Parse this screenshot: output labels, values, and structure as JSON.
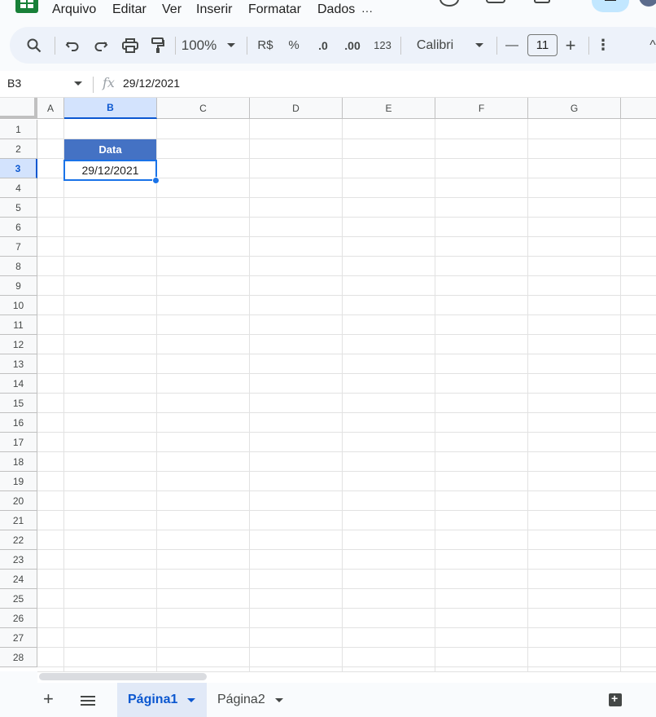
{
  "menu": {
    "items": [
      "Arquivo",
      "Editar",
      "Ver",
      "Inserir",
      "Formatar",
      "Dados"
    ],
    "more": "···"
  },
  "toolbar": {
    "zoom": "100%",
    "currency": "R$",
    "percent": "%",
    "decrease_decimal": ".0",
    "increase_decimal": ".00",
    "number_format": "123",
    "font": "Calibri",
    "font_size": "11",
    "minus": "—",
    "plus": "+",
    "more": "⋮",
    "collapse": "^"
  },
  "formula_bar": {
    "name_box": "B3",
    "fx": "fx",
    "value": "29/12/2021"
  },
  "grid": {
    "columns": [
      "A",
      "B",
      "C",
      "D",
      "E",
      "F",
      "G"
    ],
    "rows": [
      "1",
      "2",
      "3",
      "4",
      "5",
      "6",
      "7",
      "8",
      "9",
      "10",
      "11",
      "12",
      "13",
      "14",
      "15",
      "16",
      "17",
      "18",
      "19",
      "20",
      "21",
      "22",
      "23",
      "24",
      "25",
      "26",
      "27",
      "28"
    ],
    "selected_column": "B",
    "selected_row": "3",
    "cells": {
      "B2": "Data",
      "B3": "29/12/2021"
    },
    "header_fill": "#4472c4"
  },
  "sheets": {
    "tabs": [
      "Página1",
      "Página2"
    ],
    "active": "Página1"
  },
  "icons": [
    "sheets-logo-icon",
    "search-icon",
    "undo-icon",
    "redo-icon",
    "print-icon",
    "paint-format-icon",
    "add-sheet-icon",
    "all-sheets-icon",
    "explore-icon"
  ]
}
